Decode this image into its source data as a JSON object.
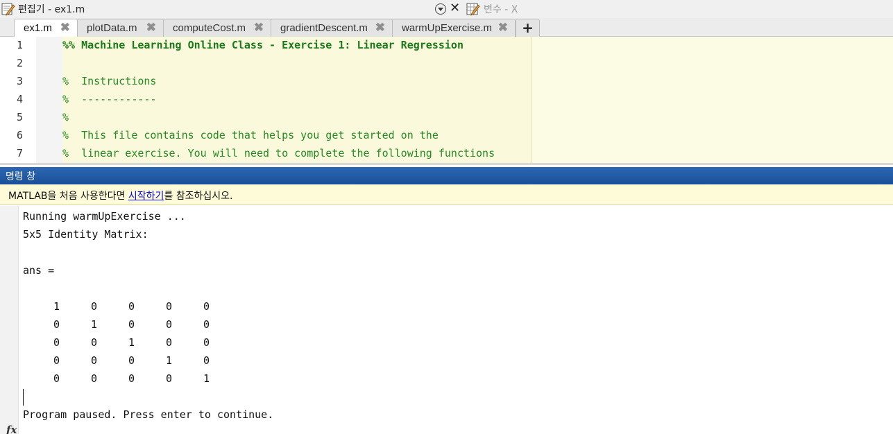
{
  "titlebar": {
    "editor_title": "편집기 - ex1.m",
    "variables_title": "변수 - X"
  },
  "tabs": [
    {
      "label": "ex1.m",
      "active": true
    },
    {
      "label": "plotData.m",
      "active": false
    },
    {
      "label": "computeCost.m",
      "active": false
    },
    {
      "label": "gradientDescent.m",
      "active": false
    },
    {
      "label": "warmUpExercise.m",
      "active": false
    }
  ],
  "tab_add_label": "+",
  "tab_close_glyph": "✖",
  "editor": {
    "lines": [
      {
        "num": "1",
        "text": "%% Machine Learning Online Class - Exercise 1: Linear Regression"
      },
      {
        "num": "2",
        "text": ""
      },
      {
        "num": "3",
        "text": "%  Instructions"
      },
      {
        "num": "4",
        "text": "%  ------------"
      },
      {
        "num": "5",
        "text": "%"
      },
      {
        "num": "6",
        "text": "%  This file contains code that helps you get started on the"
      },
      {
        "num": "7",
        "text": "%  linear exercise. You will need to complete the following functions"
      }
    ]
  },
  "command_window": {
    "title": "명령 창",
    "notice_prefix": "MATLAB을 처음 사용한다면 ",
    "notice_link": "시작하기",
    "notice_suffix": "를 참조하십시오.",
    "output_lines": [
      "Running warmUpExercise ...",
      "5x5 Identity Matrix:",
      "",
      "ans ="
    ],
    "matrix": [
      [
        "1",
        "0",
        "0",
        "0",
        "0"
      ],
      [
        "0",
        "1",
        "0",
        "0",
        "0"
      ],
      [
        "0",
        "0",
        "1",
        "0",
        "0"
      ],
      [
        "0",
        "0",
        "0",
        "1",
        "0"
      ],
      [
        "0",
        "0",
        "0",
        "0",
        "1"
      ]
    ],
    "paused_text": "Program paused. Press enter to continue.",
    "prompt_symbol": "fx"
  },
  "colors": {
    "comment_green": "#228b22",
    "editor_bg": "#fbf9db",
    "cw_header_blue": "#1f5aa6"
  }
}
